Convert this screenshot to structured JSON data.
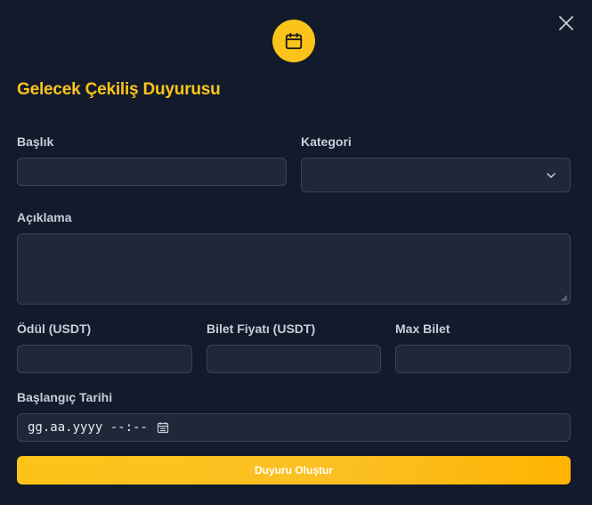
{
  "dialog": {
    "title": "Gelecek Çekiliş Duyurusu",
    "icon": "calendar-icon",
    "close_icon": "close-icon"
  },
  "form": {
    "title_label": "Başlık",
    "title_value": "",
    "category_label": "Kategori",
    "category_value": "",
    "description_label": "Açıklama",
    "description_value": "",
    "prize_label": "Ödül (USDT)",
    "prize_value": "",
    "ticket_price_label": "Bilet Fiyatı (USDT)",
    "ticket_price_value": "",
    "max_ticket_label": "Max Bilet",
    "max_ticket_value": "",
    "start_date_label": "Başlangıç Tarihi",
    "start_date_placeholder": "gg.aa.yyyy --:--",
    "submit_label": "Duyuru Oluştur"
  },
  "colors": {
    "accent": "#fcc419",
    "background": "#121a2b",
    "field_bg": "#1f2839",
    "field_border": "#3a4458"
  }
}
